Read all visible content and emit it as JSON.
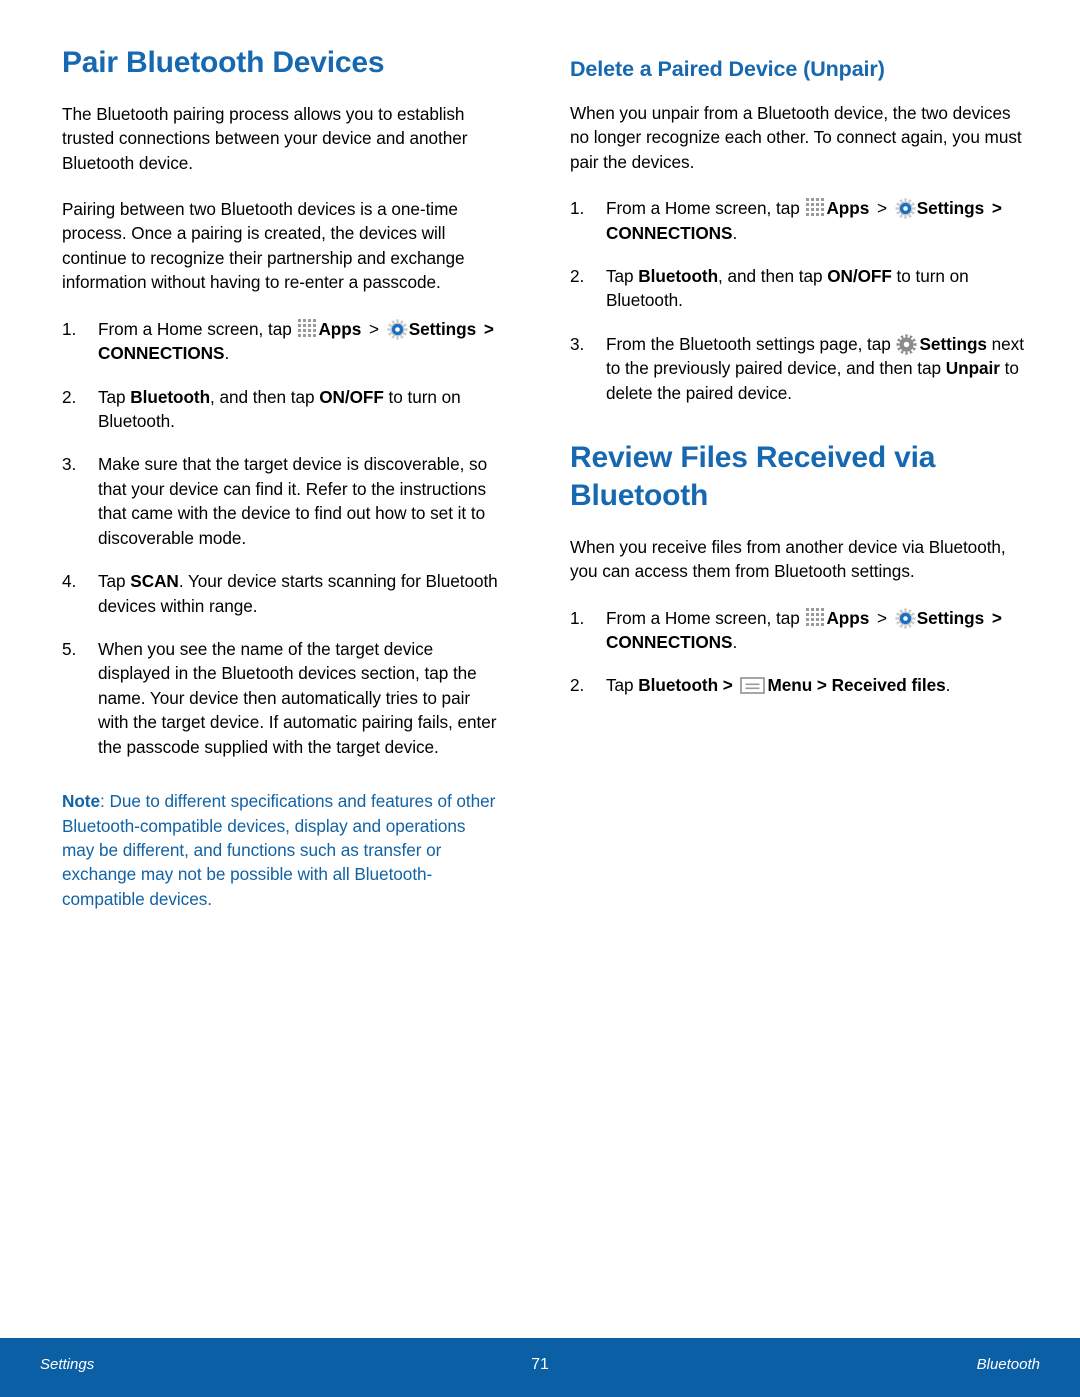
{
  "page": {
    "number": "71",
    "footer_left": "Settings",
    "footer_right": "Bluetooth",
    "accent_blue": "#1668b0",
    "note_blue": "#1262a4",
    "footer_blue": "#0a5fa5"
  },
  "left_column": {
    "title": "Pair Bluetooth Devices",
    "paragraphs": [
      "The Bluetooth pairing process allows you to establish trusted connections between your device and another Bluetooth device.",
      "Pairing between two Bluetooth devices is a one-time process. Once a pairing is created, the devices will continue to recognize their partnership and exchange information without having to re-enter a passcode."
    ],
    "steps": [
      {
        "num": "1.",
        "segments": [
          {
            "type": "text",
            "text": "From a Home screen, tap "
          },
          {
            "type": "icon",
            "icon": "apps-icon"
          },
          {
            "type": "bold",
            "text": "Apps"
          },
          {
            "type": "text",
            "text": " "
          },
          {
            "type": "chevron",
            "text": ">"
          },
          {
            "type": "text",
            "text": " "
          },
          {
            "type": "icon",
            "icon": "gear-settings-icon"
          },
          {
            "type": "bold",
            "text": "Settings"
          },
          {
            "type": "text",
            "text": " "
          },
          {
            "type": "boldchevron",
            "text": ">"
          },
          {
            "type": "bold",
            "text": " CONNECTIONS"
          },
          {
            "type": "text",
            "text": "."
          }
        ]
      },
      {
        "num": "2.",
        "segments": [
          {
            "type": "text",
            "text": "Tap "
          },
          {
            "type": "bold",
            "text": "Bluetooth"
          },
          {
            "type": "text",
            "text": ", and then tap "
          },
          {
            "type": "bold",
            "text": "ON/OFF"
          },
          {
            "type": "text",
            "text": " to turn on Bluetooth."
          }
        ]
      },
      {
        "num": "3.",
        "segments": [
          {
            "type": "text",
            "text": "Make sure that the target device is discoverable, so that your device can find it. Refer to the instructions that came with the device to find out how to set it to discoverable mode."
          }
        ]
      },
      {
        "num": "4.",
        "segments": [
          {
            "type": "text",
            "text": "Tap "
          },
          {
            "type": "bold",
            "text": "SCAN"
          },
          {
            "type": "text",
            "text": ". Your device starts scanning for Bluetooth devices within range."
          }
        ]
      },
      {
        "num": "5.",
        "segments": [
          {
            "type": "text",
            "text": "When you see the name of the target device displayed in the Bluetooth devices section, tap the name. Your device then automatically tries to pair with the target device. If automatic pairing fails, enter the passcode supplied with the target device."
          }
        ]
      }
    ],
    "note": {
      "label": "Note",
      "text": ": Due to different specifications and features of other Bluetooth-compatible devices, display and operations may be different, and functions such as transfer or exchange may not be possible with all Bluetooth-compatible devices."
    }
  },
  "right_column": {
    "subtitle": "Delete a Paired Device (Unpair)",
    "intro": "When you unpair from a Bluetooth device, the two devices no longer recognize each other. To connect again, you must pair the devices.",
    "unpair_steps": [
      {
        "num": "1.",
        "segments": [
          {
            "type": "text",
            "text": "From a Home screen, tap "
          },
          {
            "type": "icon",
            "icon": "apps-icon"
          },
          {
            "type": "bold",
            "text": "Apps"
          },
          {
            "type": "text",
            "text": " "
          },
          {
            "type": "chevron",
            "text": ">"
          },
          {
            "type": "text",
            "text": " "
          },
          {
            "type": "icon",
            "icon": "gear-settings-icon"
          },
          {
            "type": "bold",
            "text": "Settings"
          },
          {
            "type": "text",
            "text": " "
          },
          {
            "type": "boldchevron",
            "text": ">"
          },
          {
            "type": "bold",
            "text": " CONNECTIONS"
          },
          {
            "type": "text",
            "text": "."
          }
        ]
      },
      {
        "num": "2.",
        "segments": [
          {
            "type": "text",
            "text": "Tap "
          },
          {
            "type": "bold",
            "text": "Bluetooth"
          },
          {
            "type": "text",
            "text": ", and then tap "
          },
          {
            "type": "bold",
            "text": "ON/OFF"
          },
          {
            "type": "text",
            "text": " to turn on Bluetooth."
          }
        ]
      },
      {
        "num": "3.",
        "segments": [
          {
            "type": "text",
            "text": "From the Bluetooth settings page, tap "
          },
          {
            "type": "icon",
            "icon": "gear-solid-icon"
          },
          {
            "type": "bold",
            "text": "Settings"
          },
          {
            "type": "text",
            "text": " next to the previously paired device, and then tap "
          },
          {
            "type": "bold",
            "text": "Unpair"
          },
          {
            "type": "text",
            "text": " to delete the paired device."
          }
        ]
      }
    ],
    "review_title": "Review Files Received via Bluetooth",
    "review_intro": "When you receive files from another device via Bluetooth, you can access them from Bluetooth settings.",
    "review_steps": [
      {
        "num": "1.",
        "segments": [
          {
            "type": "text",
            "text": "From a Home screen, tap "
          },
          {
            "type": "icon",
            "icon": "apps-icon"
          },
          {
            "type": "bold",
            "text": "Apps"
          },
          {
            "type": "text",
            "text": " "
          },
          {
            "type": "chevron",
            "text": ">"
          },
          {
            "type": "text",
            "text": " "
          },
          {
            "type": "icon",
            "icon": "gear-settings-icon"
          },
          {
            "type": "bold",
            "text": "Settings"
          },
          {
            "type": "text",
            "text": " "
          },
          {
            "type": "boldchevron",
            "text": ">"
          },
          {
            "type": "bold",
            "text": " CONNECTIONS"
          },
          {
            "type": "text",
            "text": "."
          }
        ]
      },
      {
        "num": "2.",
        "segments": [
          {
            "type": "text",
            "text": "Tap "
          },
          {
            "type": "bold",
            "text": "Bluetooth"
          },
          {
            "type": "bold",
            "text": " >"
          },
          {
            "type": "text",
            "text": " "
          },
          {
            "type": "icon",
            "icon": "menu-icon"
          },
          {
            "type": "bold",
            "text": "Menu"
          },
          {
            "type": "bold",
            "text": " > "
          },
          {
            "type": "bold",
            "text": "Received files"
          },
          {
            "type": "text",
            "text": "."
          }
        ]
      }
    ]
  }
}
